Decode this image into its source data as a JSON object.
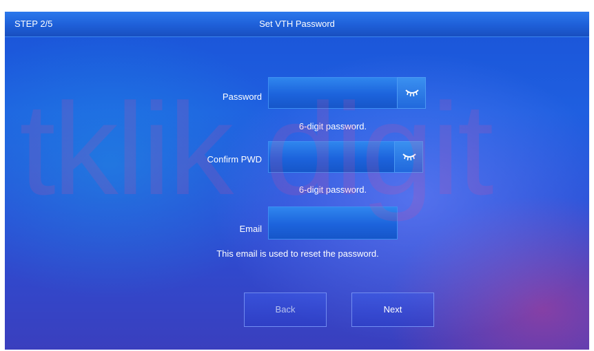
{
  "header": {
    "step": "STEP 2/5",
    "title": "Set VTH Password"
  },
  "form": {
    "password": {
      "label": "Password",
      "value": "",
      "hint": "6-digit password.",
      "toggle_icon": "eye-closed-icon"
    },
    "confirm": {
      "label": "Confirm PWD",
      "value": "",
      "hint": "6-digit password.",
      "toggle_icon": "eye-closed-icon"
    },
    "email": {
      "label": "Email",
      "value": "",
      "hint": "This email is used to reset the password."
    }
  },
  "buttons": {
    "back": "Back",
    "next": "Next"
  },
  "watermark": {
    "text": "tklik digit"
  },
  "colors": {
    "titlebar": "#1e5fd8",
    "field": "#1c63dc",
    "watermark": "#eb468c"
  }
}
